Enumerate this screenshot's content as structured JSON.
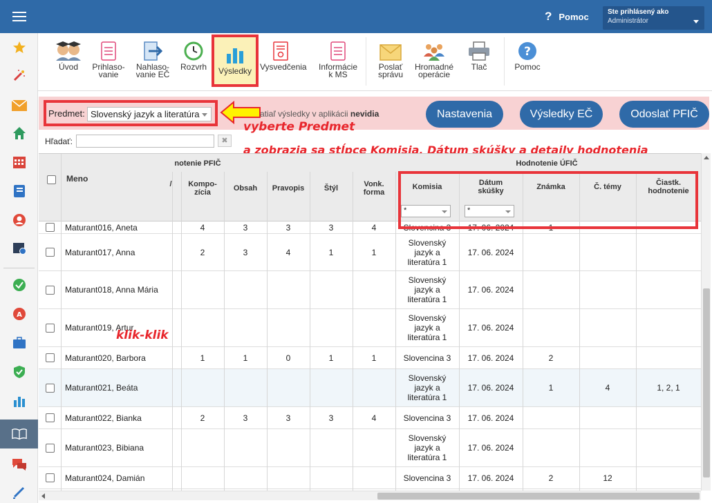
{
  "topbar": {
    "help_label": "Pomoc",
    "help_glyph": "?",
    "user_line1": "Ste prihlásený ako",
    "user_line2": "Administrátor"
  },
  "toolbar": {
    "uvod": "Úvod",
    "prihlasovanie": "Prihlaso-\nvanie",
    "nahlasovanie": "Nahlaso-\nvanie EČ",
    "rozvrh": "Rozvrh",
    "vysledky": "Výsledky",
    "vysvedcenia": "Vysvedčenia",
    "informacie": "Informácie\nk MS",
    "poslat": "Poslať\nsprávu",
    "hromadne": "Hromadné\noperácie",
    "tlac": "Tlač",
    "pomoc": "Pomoc"
  },
  "filter": {
    "predmet_label": "Predmet:",
    "predmet_value": "Slovenský jazyk a literatúra",
    "info_prefix": "atiaľ výsledky v aplikácii",
    "info_bold": "nevidia",
    "btn_nastavenia": "Nastavenia",
    "btn_vysledky_ec": "Výsledky EČ",
    "btn_odoslat": "Odoslať PFIČ",
    "search_label": "Hľadať:",
    "search_value": "",
    "clear_glyph": "✖"
  },
  "annotations": {
    "line1": "vyberte Predmet",
    "line2": "a zobrazia sa stĺpce Komisia, Dátum skúšky a detaily hodnotenia",
    "click": "klik-klik"
  },
  "table": {
    "meno_header": "Meno",
    "pfic_group": "notenie PFIČ",
    "ufic_group": "Hodnotenie ÚFIČ",
    "partial_col": "/",
    "cols": {
      "kompozicia": "Kompo-\nzícia",
      "obsah": "Obsah",
      "pravopis": "Pravopis",
      "styl": "Štýl",
      "vonk": "Vonk.\nforma",
      "komisia": "Komisia",
      "datum": "Dátum\nskúšky",
      "znamka": "Známka",
      "ctemy": "Č. témy",
      "ciastk": "Čiastk.\nhodnotenie"
    },
    "filter_komisia": "*",
    "filter_datum": "*",
    "rows": [
      {
        "name": "Maturant016, Aneta",
        "k": "4",
        "o": "3",
        "p": "3",
        "s": "3",
        "v": "4",
        "kom": "Slovencina 3",
        "dat": "17. 06. 2024",
        "zn": "1",
        "ct": "",
        "ch": ""
      },
      {
        "name": "Maturant017, Anna",
        "k": "2",
        "o": "3",
        "p": "4",
        "s": "1",
        "v": "1",
        "kom": "Slovenský\njazyk a\nliteratúra 1",
        "dat": "17. 06. 2024",
        "zn": "",
        "ct": "",
        "ch": ""
      },
      {
        "name": "Maturant018, Anna Mária",
        "k": "",
        "o": "",
        "p": "",
        "s": "",
        "v": "",
        "kom": "Slovenský\njazyk a\nliteratúra 1",
        "dat": "17. 06. 2024",
        "zn": "",
        "ct": "",
        "ch": ""
      },
      {
        "name": "Maturant019, Artur",
        "k": "",
        "o": "",
        "p": "",
        "s": "",
        "v": "",
        "kom": "Slovenský\njazyk a\nliteratúra 1",
        "dat": "17. 06. 2024",
        "zn": "",
        "ct": "",
        "ch": ""
      },
      {
        "name": "Maturant020, Barbora",
        "k": "1",
        "o": "1",
        "p": "0",
        "s": "1",
        "v": "1",
        "kom": "Slovencina 3",
        "dat": "17. 06. 2024",
        "zn": "2",
        "ct": "",
        "ch": ""
      },
      {
        "name": "Maturant021, Beáta",
        "k": "",
        "o": "",
        "p": "",
        "s": "",
        "v": "",
        "kom": "Slovenský\njazyk a\nliteratúra 1",
        "dat": "17. 06. 2024",
        "zn": "1",
        "ct": "4",
        "ch": "1, 2, 1"
      },
      {
        "name": "Maturant022, Bianka",
        "k": "2",
        "o": "3",
        "p": "3",
        "s": "3",
        "v": "4",
        "kom": "Slovencina 3",
        "dat": "17. 06. 2024",
        "zn": "",
        "ct": "",
        "ch": ""
      },
      {
        "name": "Maturant023, Bibiana",
        "k": "",
        "o": "",
        "p": "",
        "s": "",
        "v": "",
        "kom": "Slovenský\njazyk a\nliteratúra 1",
        "dat": "17. 06. 2024",
        "zn": "",
        "ct": "",
        "ch": ""
      },
      {
        "name": "Maturant024, Damián",
        "k": "",
        "o": "",
        "p": "",
        "s": "",
        "v": "",
        "kom": "Slovencina 3",
        "dat": "17. 06. 2024",
        "zn": "2",
        "ct": "12",
        "ch": ""
      }
    ]
  },
  "colors": {
    "brand": "#2f6aa8",
    "highlight": "#e8343a",
    "pink": "#f8d2d3"
  },
  "icons": {
    "nav": [
      "star-icon",
      "magic-wand-icon",
      "envelope-icon",
      "home-icon",
      "calendar-grid-icon",
      "notebook-icon",
      "user-icon",
      "calendar-clock-icon",
      "check-icon",
      "grade-icon",
      "briefcase-icon",
      "shield-icon",
      "bar-chart-icon",
      "open-book-icon",
      "chat-icon",
      "pen-icon"
    ]
  }
}
